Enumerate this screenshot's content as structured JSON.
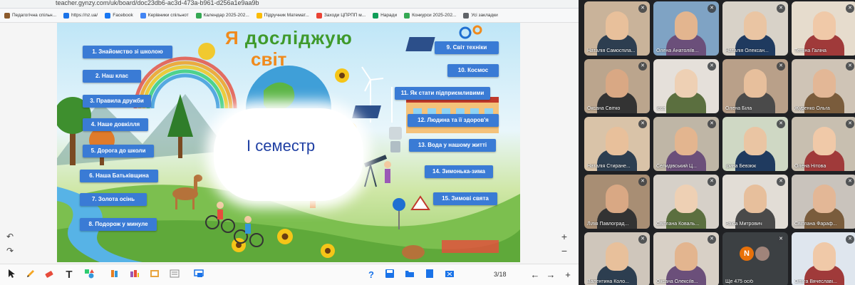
{
  "browser": {
    "url": "teacher.gynzy.com/uk/board/doc23db6-ac3d-473a-b961-d256a1e9aa9b",
    "bookmarks": [
      {
        "label": "Педагогічна спільн...",
        "color": "#8b5a2b"
      },
      {
        "label": "https://nz.ua/",
        "color": "#1a73e8"
      },
      {
        "label": "Facebook",
        "color": "#1877f2"
      },
      {
        "label": "Керівники спільнот",
        "color": "#4285f4"
      },
      {
        "label": "Календар 2025-202...",
        "color": "#34a853"
      },
      {
        "label": "Підручник Математ...",
        "color": "#fbbc04"
      },
      {
        "label": "Заходи ЦПРПП м...",
        "color": "#ea4335"
      },
      {
        "label": "Наради",
        "color": "#0f9d58"
      },
      {
        "label": "Конкурси 2025-202...",
        "color": "#34a853"
      },
      {
        "label": "Усі закладки",
        "color": "#5f6368"
      }
    ]
  },
  "slide": {
    "title_line1": "Я досліджую",
    "title_line2": "світ",
    "semester": "І семестр",
    "left_items": [
      "1. Знайомство зі школою",
      "2. Наш клас",
      "3. Правила дружби",
      "4. Наше довкілля",
      "5. Дорога до школи",
      "6. Наша Батьківщина",
      "7. Золота осінь",
      "8. Подорож у минуле"
    ],
    "right_items": [
      "9. Світ техніки",
      "10. Космос",
      "11. Як стати підприємливими",
      "12. Людина та її здоров'я",
      "13. Вода у нашому житті",
      "14. Зимонька-зима",
      "15. Зимові свята"
    ],
    "colors": {
      "button": "#3a7bd5",
      "title_orange": "#f08a1c",
      "title_green": "#3f9a2c",
      "semester": "#1f3fa3"
    }
  },
  "side_tools": {
    "undo_icon": "↶",
    "redo_icon": "↷",
    "zoom_in": "+",
    "zoom_out": "−"
  },
  "toolbar": {
    "page": "3/18",
    "icons": [
      "pointer-icon",
      "pen-icon",
      "eraser-icon",
      "text-icon",
      "shapes-icon",
      "library-icon",
      "widgets-icon",
      "image-icon",
      "list-icon",
      "screen-share-icon",
      "help-icon",
      "save-icon",
      "folder-icon",
      "file-icon",
      "clear-icon",
      "prev-icon",
      "next-icon",
      "add-icon"
    ]
  },
  "meeting": {
    "participants": [
      "Наталія Самоспіла...",
      "Олена Анатоліїв...",
      "Наталія Олексан...",
      "Тетяна Галіна",
      "Оксана Світко",
      "Ісса",
      "Олена Біла",
      "Журенко Ольга",
      "Наталія Стиране...",
      "Селидівський Ц...",
      "Ірина Бевзюк",
      "Олена Нітова",
      "Лілія Павлоград...",
      "Світлана Коваль...",
      "Раїса Митрович",
      "Світлана Фараф...",
      "Валентина Коло...",
      "Оксана Олексіїв...",
      "Ще 475 осіб",
      "Ольга Вячеславі..."
    ],
    "more_avatar_letter": "N"
  }
}
